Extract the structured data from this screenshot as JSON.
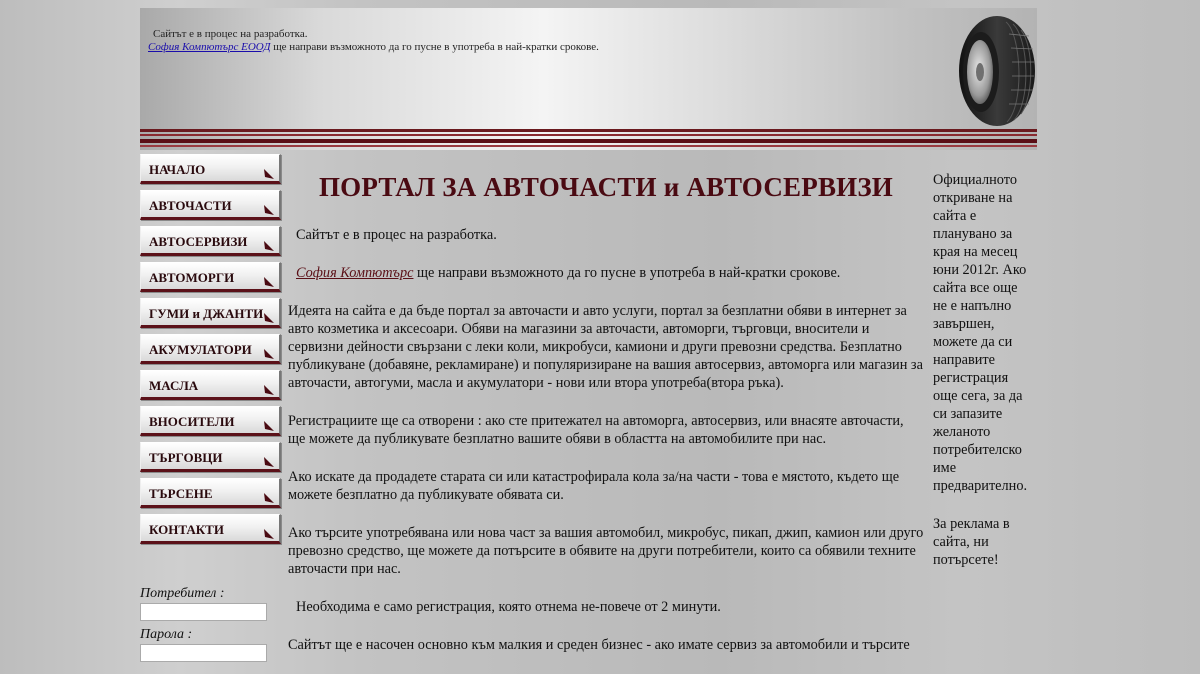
{
  "header": {
    "notice_line1": "Сайтът е в процес на разработка.",
    "company_link": "София Компютърс ЕООД",
    "notice_line2_rest": " ще направи възможното да го пусне в употреба в най-кратки срокове."
  },
  "nav": {
    "items": [
      {
        "label": "НАЧАЛО"
      },
      {
        "label": "АВТОЧАСТИ"
      },
      {
        "label": "АВТОСЕРВИЗИ"
      },
      {
        "label": "АВТОМОРГИ"
      },
      {
        "label": "ГУМИ и ДЖАНТИ"
      },
      {
        "label": "АКУМУЛАТОРИ"
      },
      {
        "label": "МАСЛА"
      },
      {
        "label": "ВНОСИТЕЛИ"
      },
      {
        "label": "ТЪРГОВЦИ"
      },
      {
        "label": "ТЪРСЕНЕ"
      },
      {
        "label": "КОНТАКТИ"
      }
    ]
  },
  "login": {
    "user_label": "Потребител :",
    "password_label": "Парола :",
    "user_value": "",
    "password_value": ""
  },
  "main": {
    "title": "ПОРТАЛ ЗА АВТОЧАСТИ и АВТОСЕРВИЗИ",
    "p1": "Сайтът е в процес на разработка.",
    "p2_link": "София Компютърс",
    "p2_rest": " ще направи възможното да го пусне в употреба в най-кратки срокове.",
    "p3": "Идеята на сайта е да бъде портал за авточасти и авто услуги, портал за безплатни обяви в интернет за авто козметика и аксесоари. Обяви на магазини за авточасти, автоморги, търговци, вносители и сервизни дейности свързани с леки коли, микробуси, камиони и други превозни средства. Безплатно публикуване (добавяне, рекламиране) и популяризиране на вашия автосервиз, автоморга или магазин за авточасти, автогуми, масла и акумулатори - нови или втора употреба(втора ръка).",
    "p4": "Регистрациите ще са отворени : ако сте притежател на автоморга, автосервиз, или внасяте авточасти, ще можете да публикувате безплатно вашите обяви в областта на автомобилите при нас.",
    "p5": "Ако искате да продадете старата си или катастрофирала кола за/на части - това е мястото, където ще можете безплатно да публикувате обявата си.",
    "p6": "Ако търсите употребявана или нова част за вашия автомобил, микробус, пикап, джип, камион или друго превозно средство, ще можете да потърсите в обявите на други потребители, които са обявили техните авточасти при нас.",
    "p7": "Необходима е само регистрация, която отнема не-повече от 2 минути.",
    "p8": "Сайтът ще е насочен основно към малкия и среден бизнес - ако имате сервиз за автомобили и търсите"
  },
  "right": {
    "p1": "Официалното откриване на сайта е планувано за края на месец юни 2012г. Ако сайта все още не е напълно завършен, можете да си направите регистрация още сега, за да си запазите желаното потребителско име предварително.",
    "p2": "За реклама в сайта, ни потърсете!"
  }
}
